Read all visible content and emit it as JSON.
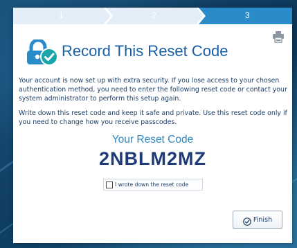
{
  "stepper": {
    "steps": [
      "1",
      "2",
      "3"
    ],
    "active_step": 3,
    "colors": {
      "inactive": "#e3eef8",
      "inactive_text": "#ffffff",
      "active": "#2a8bc9"
    }
  },
  "toolbar": {
    "print_icon": "printer-icon"
  },
  "header": {
    "icon": "lock-check-icon",
    "title": "Record This Reset Code"
  },
  "body": {
    "paragraph1": "Your account is now set up with extra security. If you lose access to your chosen authentication method, you need to enter the following reset code or contact your system administrator to perform this setup again.",
    "paragraph2": "Write down this reset code and keep it safe and private. Use this reset code only if you need to change how you receive passcodes."
  },
  "reset_code": {
    "label": "Your Reset Code",
    "value": "2NBLM2MZ"
  },
  "confirmation": {
    "label": "I wrote down the reset code",
    "checked": false
  },
  "footer": {
    "finish_label": "Finish",
    "finish_icon": "check-circle-icon"
  }
}
